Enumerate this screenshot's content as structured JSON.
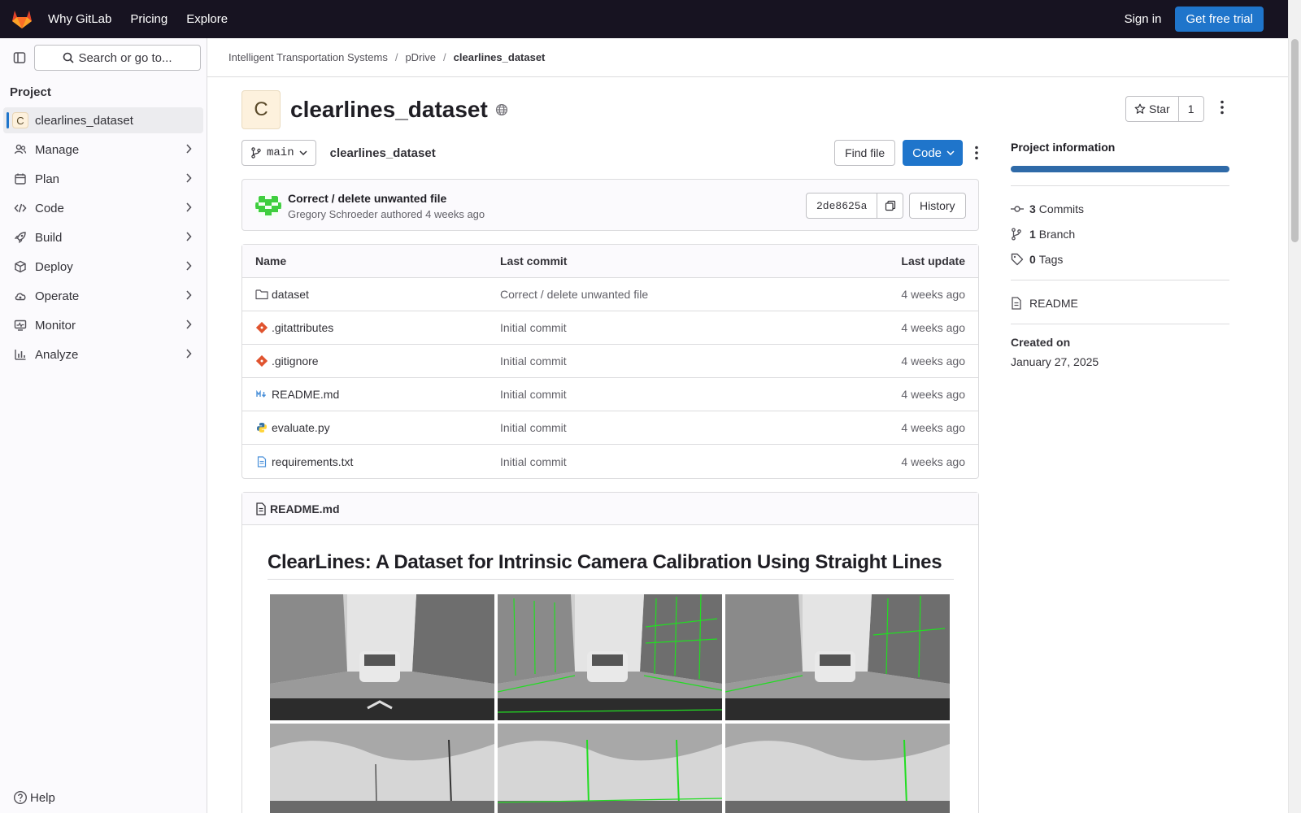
{
  "topbar": {
    "nav": [
      "Why GitLab",
      "Pricing",
      "Explore"
    ],
    "sign_in": "Sign in",
    "trial": "Get free trial"
  },
  "sidebar": {
    "search_placeholder": "Search or go to...",
    "section": "Project",
    "project_avatar": "C",
    "project_name": "clearlines_dataset",
    "items": [
      {
        "label": "Manage",
        "icon": "users-icon"
      },
      {
        "label": "Plan",
        "icon": "planning-icon"
      },
      {
        "label": "Code",
        "icon": "code-icon"
      },
      {
        "label": "Build",
        "icon": "rocket-icon"
      },
      {
        "label": "Deploy",
        "icon": "deployments-icon"
      },
      {
        "label": "Operate",
        "icon": "cloud-icon"
      },
      {
        "label": "Monitor",
        "icon": "monitor-icon"
      },
      {
        "label": "Analyze",
        "icon": "chart-icon"
      }
    ],
    "help": "Help"
  },
  "breadcrumb": [
    "Intelligent Transportation Systems",
    "pDrive",
    "clearlines_dataset"
  ],
  "project": {
    "avatar": "C",
    "title": "clearlines_dataset",
    "star_label": "Star",
    "star_count": "1"
  },
  "repo": {
    "branch": "main",
    "path": "clearlines_dataset",
    "find_file": "Find file",
    "code": "Code"
  },
  "commit": {
    "title": "Correct / delete unwanted file",
    "author": "Gregory Schroeder",
    "action": "authored",
    "time": "4 weeks ago",
    "sha": "2de8625a",
    "history": "History"
  },
  "files": {
    "headers": [
      "Name",
      "Last commit",
      "Last update"
    ],
    "rows": [
      {
        "name": "dataset",
        "commit": "Correct / delete unwanted file",
        "date": "4 weeks ago",
        "icon": "folder-icon"
      },
      {
        "name": ".gitattributes",
        "commit": "Initial commit",
        "date": "4 weeks ago",
        "icon": "git-icon"
      },
      {
        "name": ".gitignore",
        "commit": "Initial commit",
        "date": "4 weeks ago",
        "icon": "git-icon"
      },
      {
        "name": "README.md",
        "commit": "Initial commit",
        "date": "4 weeks ago",
        "icon": "markdown-icon"
      },
      {
        "name": "evaluate.py",
        "commit": "Initial commit",
        "date": "4 weeks ago",
        "icon": "python-icon"
      },
      {
        "name": "requirements.txt",
        "commit": "Initial commit",
        "date": "4 weeks ago",
        "icon": "document-icon"
      }
    ]
  },
  "readme": {
    "filename": "README.md",
    "title": "ClearLines: A Dataset for Intrinsic Camera Calibration Using Straight Lines"
  },
  "project_info": {
    "title": "Project information",
    "commits_count": "3",
    "commits_label": "Commits",
    "branch_count": "1",
    "branch_label": "Branch",
    "tags_count": "0",
    "tags_label": "Tags",
    "readme_link": "README",
    "created_label": "Created on",
    "created_date": "January 27, 2025"
  },
  "colors": {
    "topbar": "#171321",
    "accent": "#1f75cb",
    "line_overlay": "#22dd22"
  }
}
